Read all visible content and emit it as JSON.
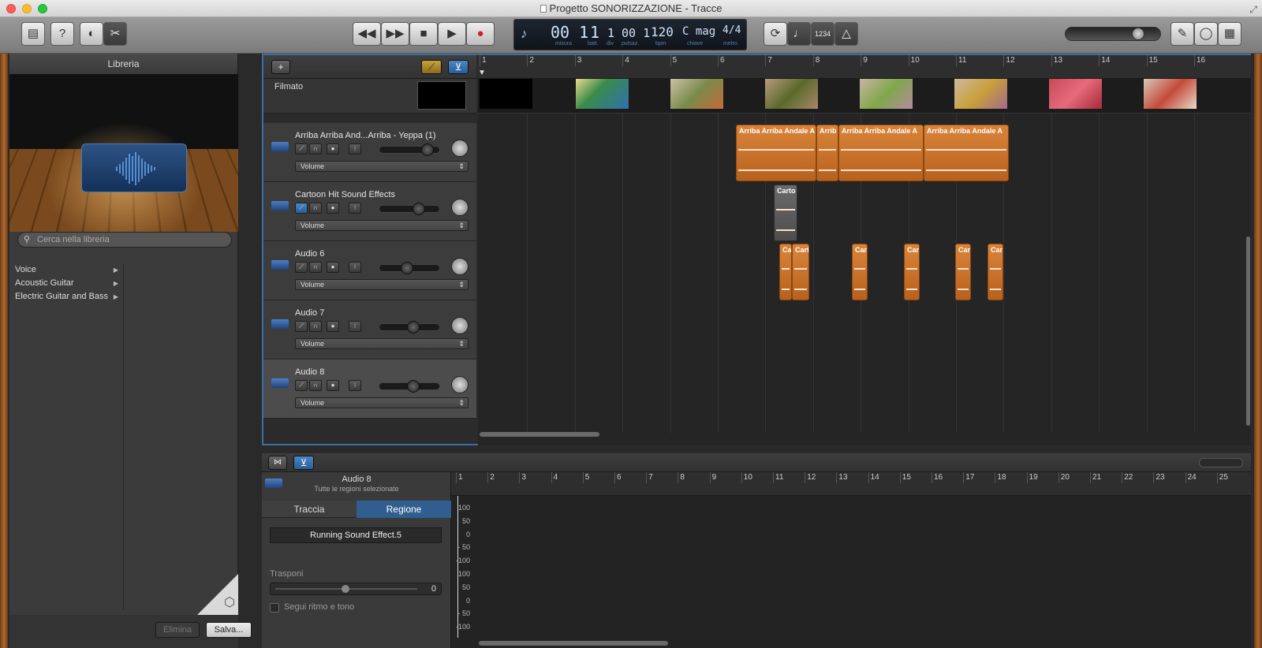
{
  "window": {
    "title": "Progetto SONORIZZAZIONE - Tracce"
  },
  "toolbar": {
    "lcd": {
      "measure": "00 1",
      "beat": "1",
      "div": "1",
      "pulse": "00 1",
      "tempo": "120",
      "key": "C mag",
      "signature": "4/4",
      "captions": {
        "measure": "misura",
        "beat": "batt.",
        "div": "div",
        "pulse": "pulsaz.",
        "tempo": "bpm",
        "key": "chiave",
        "signature": "metro"
      }
    },
    "count_in": "1234"
  },
  "library": {
    "title": "Libreria",
    "search_placeholder": "Cerca nella libreria",
    "items": [
      {
        "label": "Voice"
      },
      {
        "label": "Acoustic Guitar"
      },
      {
        "label": "Electric Guitar and Bass"
      }
    ],
    "delete_label": "Elimina",
    "save_label": "Salva..."
  },
  "tracks": {
    "movie_label": "Filmato",
    "items": [
      {
        "name": "Arriba Arriba And...Arriba - Yeppa (1)",
        "automation": "Volume",
        "volume": 0.85,
        "selected": false
      },
      {
        "name": "Cartoon Hit Sound Effects",
        "automation": "Volume",
        "volume": 0.68,
        "selected": false
      },
      {
        "name": "Audio 6",
        "automation": "Volume",
        "volume": 0.44,
        "selected": false
      },
      {
        "name": "Audio 7",
        "automation": "Volume",
        "volume": 0.56,
        "selected": false
      },
      {
        "name": "Audio 8",
        "automation": "Volume",
        "volume": 0.56,
        "selected": true
      }
    ]
  },
  "ruler": {
    "bars": [
      "1",
      "2",
      "3",
      "4",
      "5",
      "6",
      "7",
      "8",
      "9",
      "10",
      "11",
      "12",
      "13",
      "14",
      "15",
      "16"
    ]
  },
  "regions": {
    "arriba_label": "Arriba Arriba Andale A",
    "arriba_short": "Arrib",
    "cartoon_label": "Carto",
    "cart_label": "Cart",
    "ca_label": "Ca"
  },
  "editor": {
    "track_name": "Audio 8",
    "subtitle": "Tutte le regioni selezionate",
    "tabs": [
      {
        "label": "Traccia"
      },
      {
        "label": "Regione"
      }
    ],
    "region_name": "Running Sound Effect.5",
    "transpose_label": "Trasponi",
    "transpose_value": "0",
    "follow_label": "Segui ritmo e tono",
    "ruler_bars": [
      "1",
      "2",
      "3",
      "4",
      "5",
      "6",
      "7",
      "8",
      "9",
      "10",
      "11",
      "12",
      "13",
      "14",
      "15",
      "16",
      "17",
      "18",
      "19",
      "20",
      "21",
      "22",
      "23",
      "24",
      "25"
    ],
    "y_labels": [
      "100",
      "50",
      "0",
      "- 50",
      "-100",
      "100",
      "50",
      "0",
      "- 50",
      "-100"
    ]
  },
  "colors": {
    "accent": "#3b6fa3",
    "region": "#d9843a",
    "selected_tab": "#2f5e8f"
  }
}
